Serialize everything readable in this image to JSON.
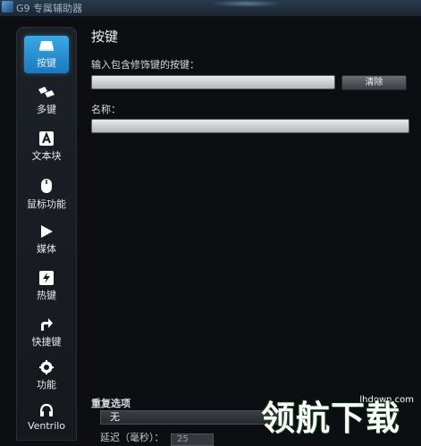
{
  "window": {
    "title": "G9 专属辅助器"
  },
  "sidebar": {
    "items": [
      {
        "label": "按键",
        "icon": "key-icon",
        "active": true
      },
      {
        "label": "多键",
        "icon": "multi-key-icon",
        "active": false
      },
      {
        "label": "文本块",
        "icon": "text-block-icon",
        "active": false
      },
      {
        "label": "鼠标功能",
        "icon": "mouse-icon",
        "active": false
      },
      {
        "label": "媒体",
        "icon": "media-play-icon",
        "active": false
      },
      {
        "label": "热键",
        "icon": "hotkey-icon",
        "active": false
      },
      {
        "label": "快捷键",
        "icon": "shortcut-arrow-icon",
        "active": false
      },
      {
        "label": "功能",
        "icon": "function-gear-icon",
        "active": false
      },
      {
        "label": "Ventrilo",
        "icon": "headset-icon",
        "active": false
      }
    ]
  },
  "main": {
    "heading": "按键",
    "key_field": {
      "label": "输入包含修饰键的按键：",
      "value": ""
    },
    "clear_button": "清除",
    "name_field": {
      "label": "名称：",
      "value": ""
    },
    "repeat": {
      "label": "重复选项",
      "selected": "无",
      "delay_label": "延迟（毫秒）：",
      "delay_value": "25"
    }
  },
  "watermark": {
    "url": "lhdown.com",
    "text": "领航下载"
  },
  "colors": {
    "accent": "#2a92d6",
    "background": "#0c0e12",
    "watermark_green": "#3fbf3a"
  }
}
